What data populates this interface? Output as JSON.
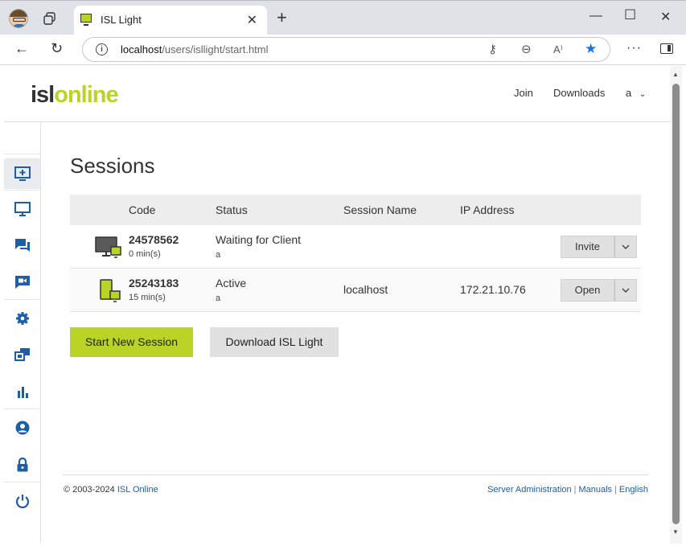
{
  "browser": {
    "tab_title": "ISL Light",
    "url_host": "localhost",
    "url_path": "/users/isllight/start.html"
  },
  "header": {
    "logo_isl": "isl",
    "logo_online": "online",
    "nav": {
      "join": "Join",
      "downloads": "Downloads",
      "user": "a"
    }
  },
  "sidebar": {
    "items": [
      {
        "icon": "new-session-icon",
        "active": true
      },
      {
        "icon": "monitor-icon"
      },
      {
        "icon": "chat-icon"
      },
      {
        "icon": "video-icon"
      },
      {
        "icon": "gear-icon"
      },
      {
        "icon": "multi-window-icon"
      },
      {
        "icon": "bar-chart-icon"
      },
      {
        "icon": "user-circle-icon"
      },
      {
        "icon": "lock-icon"
      },
      {
        "icon": "power-icon"
      }
    ]
  },
  "main": {
    "title": "Sessions",
    "columns": {
      "code": "Code",
      "status": "Status",
      "session_name": "Session Name",
      "ip": "IP Address"
    },
    "rows": [
      {
        "code": "24578562",
        "duration": "0 min(s)",
        "status": "Waiting for Client",
        "user": "a",
        "session_name": "",
        "ip": "",
        "action": "Invite"
      },
      {
        "code": "25243183",
        "duration": "15 min(s)",
        "status": "Active",
        "user": "a",
        "session_name": "localhost",
        "ip": "172.21.10.76",
        "action": "Open"
      }
    ],
    "start_button": "Start New Session",
    "download_button": "Download ISL Light"
  },
  "footer": {
    "copyright": "© 2003-2024",
    "brand": "ISL Online",
    "links": {
      "server_admin": "Server Administration",
      "manuals": "Manuals",
      "language": "English"
    }
  },
  "colors": {
    "brand_green": "#b9d427",
    "link_blue": "#1d5ea8",
    "sidebar_icon": "#1d5ea8"
  }
}
